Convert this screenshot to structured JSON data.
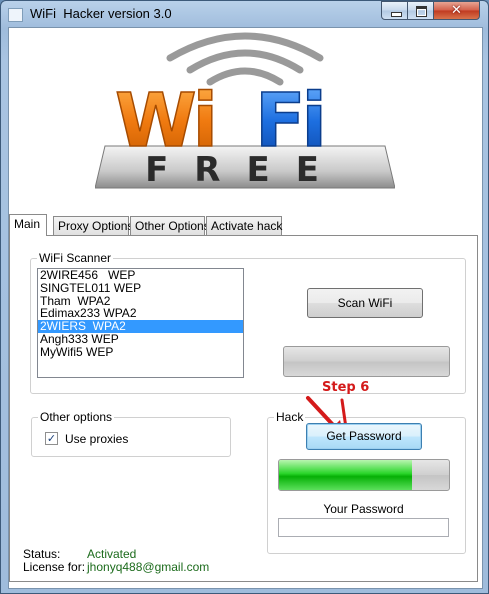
{
  "window": {
    "title": "WiFi  Hacker version 3.0"
  },
  "logo": {
    "word_left": "Wi",
    "word_right": "Fi",
    "word_bottom": "FREE"
  },
  "tabs": [
    {
      "label": "Main"
    },
    {
      "label": "Proxy Options"
    },
    {
      "label": "Other Options"
    },
    {
      "label": "Activate hack"
    }
  ],
  "scanner": {
    "group_label": "WiFi Scanner",
    "networks": [
      "2WIRE456   WEP",
      "SINGTEL011 WEP",
      "Tham  WPA2",
      "Edimax233 WPA2",
      "2WIERS  WPA2",
      "Angh333 WEP",
      "MyWifi5 WEP"
    ],
    "selected_index": 4,
    "scan_button": "Scan WiFi",
    "scan_progress": 0
  },
  "other_options": {
    "group_label": "Other options",
    "use_proxies_label": "Use proxies",
    "use_proxies_checked": true
  },
  "hack": {
    "group_label": "Hack",
    "get_password_button": "Get Password",
    "progress": 0.78,
    "password_label": "Your Password",
    "password_value": ""
  },
  "annotation": {
    "text": "Step 6",
    "color": "#d41a1a"
  },
  "status": {
    "status_label": "Status:",
    "status_value": "Activated",
    "license_label": "License for:",
    "license_value": "jhonyq488@gmail.com"
  },
  "colors": {
    "selection": "#3399ff",
    "progress_green": "#06b006",
    "status_green": "#1c6b1c"
  }
}
